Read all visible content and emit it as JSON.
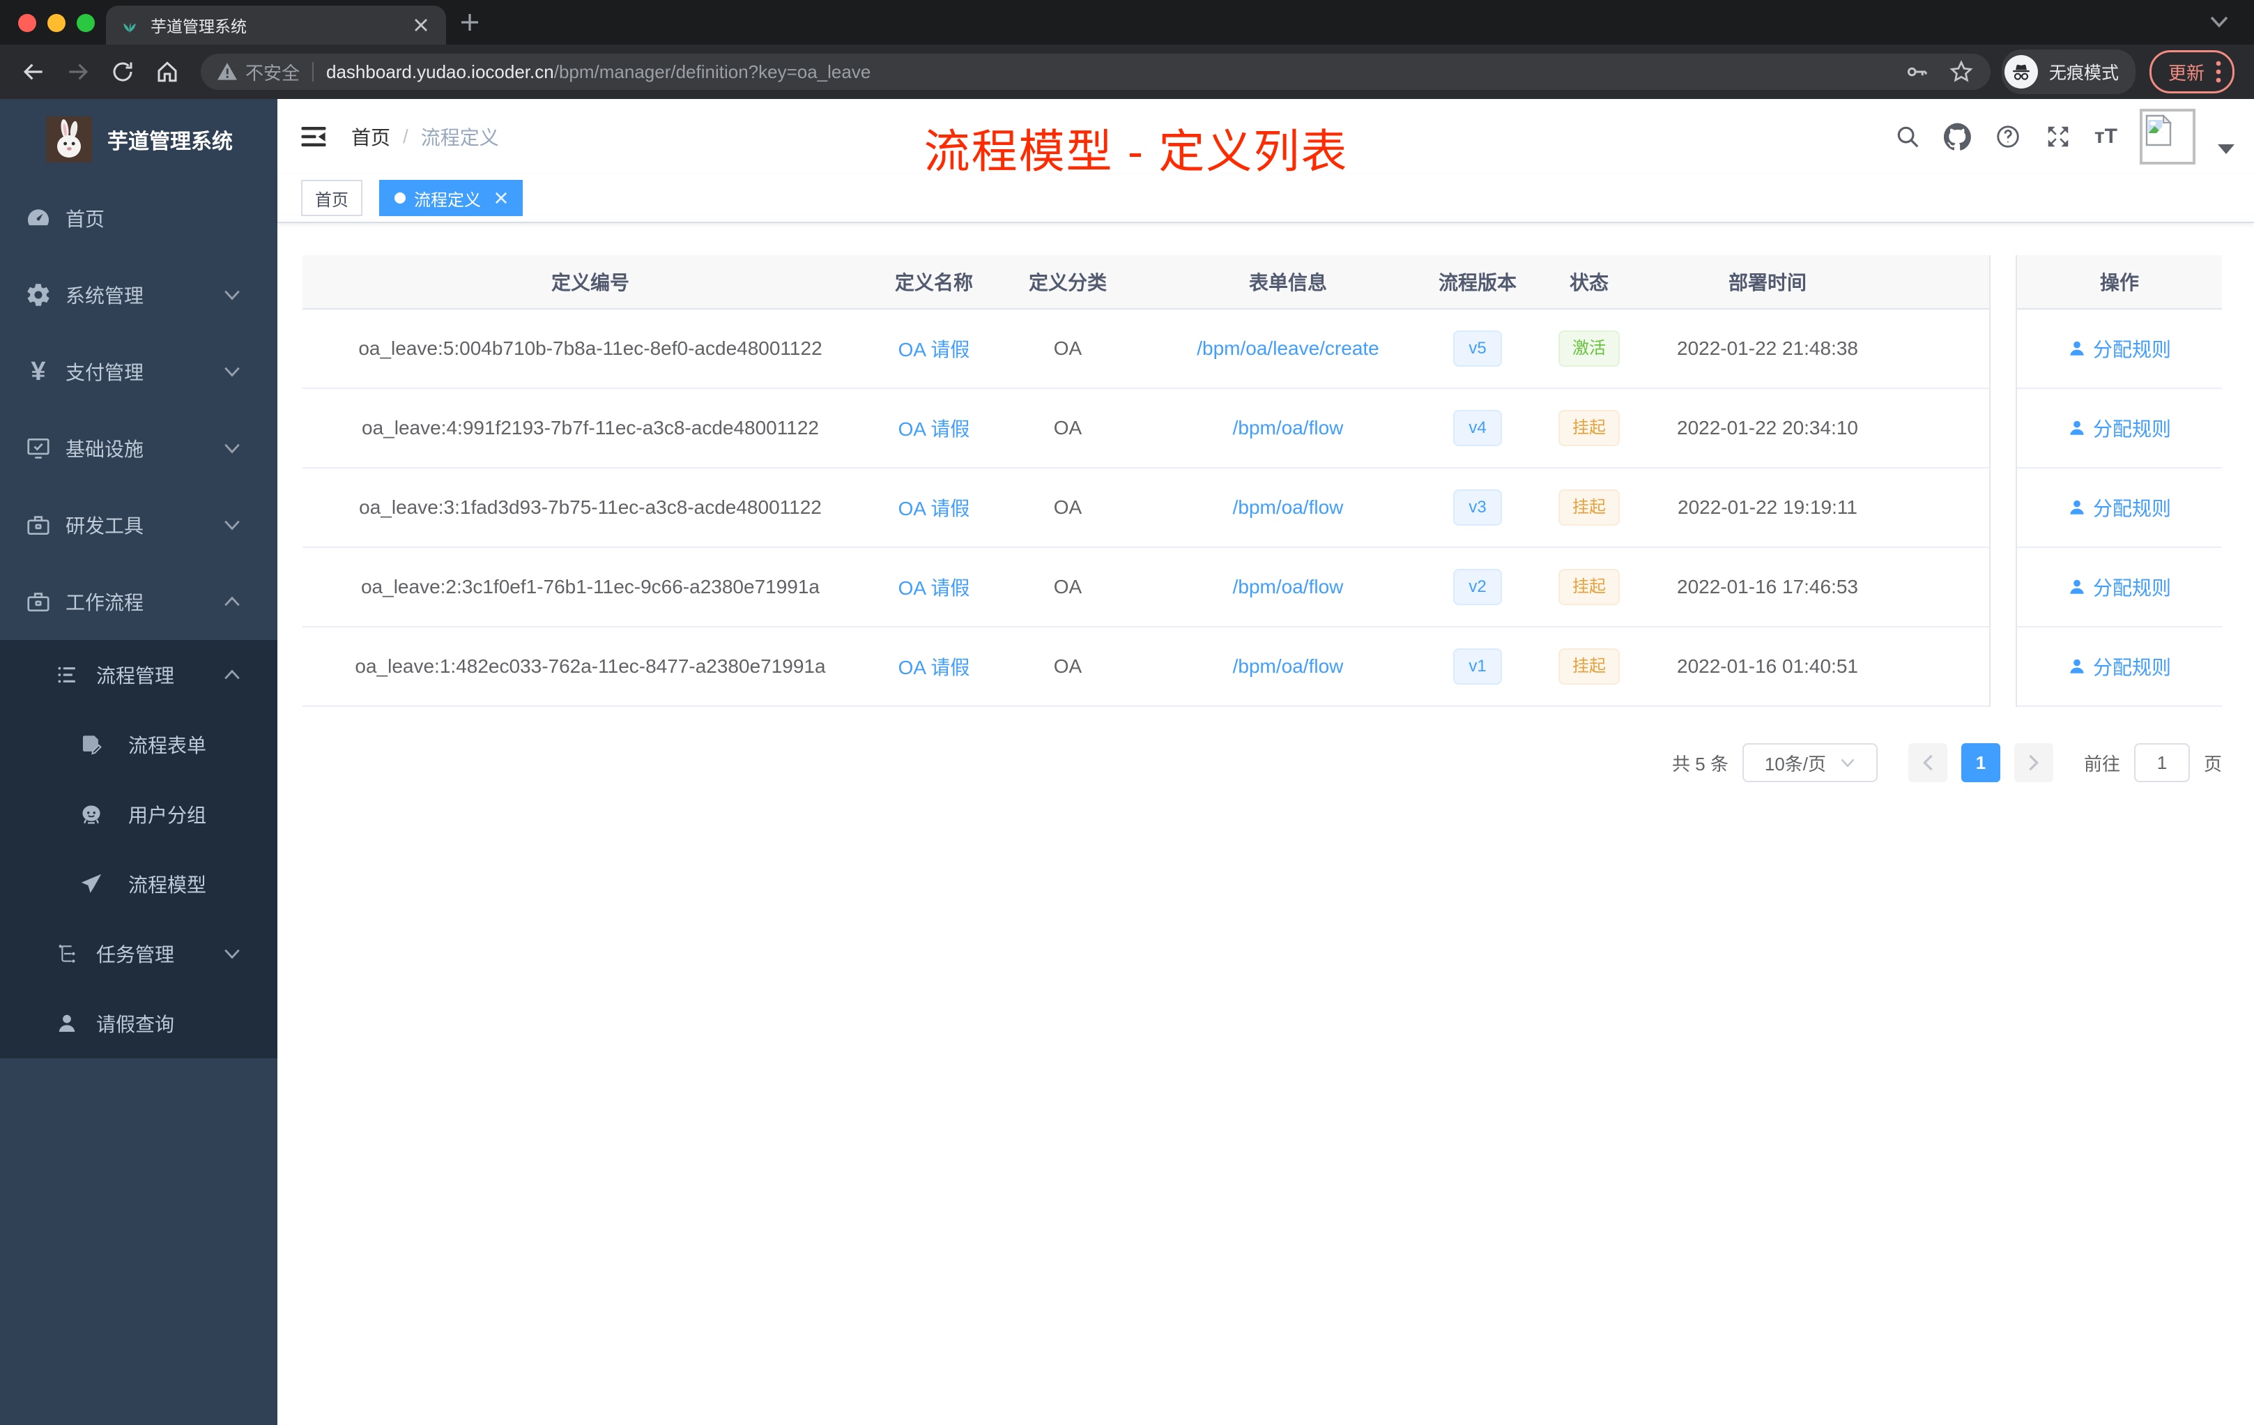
{
  "colors": {
    "accent": "#409eff",
    "success_text": "#67c23a",
    "warning_text": "#e6a23c",
    "annotation_red": "#ff2b00",
    "sidebar_bg": "#304156",
    "submenu_bg": "#1f2d3d"
  },
  "browser": {
    "tab_title": "芋道管理系统",
    "security_label": "不安全",
    "url_host": "dashboard.yudao.iocoder.cn",
    "url_path": "/bpm/manager/definition?key=oa_leave",
    "incognito_label": "无痕模式",
    "update_label": "更新"
  },
  "app_header": {
    "breadcrumb_home": "首页",
    "breadcrumb_sep": "/",
    "breadcrumb_current": "流程定义",
    "annotation": "流程模型 - 定义列表"
  },
  "tags_view": {
    "tag_home": "首页",
    "tag_active": "流程定义"
  },
  "sidebar": {
    "logo_title": "芋道管理系统",
    "menu": [
      {
        "label": "首页"
      },
      {
        "label": "系统管理"
      },
      {
        "label": "支付管理"
      },
      {
        "label": "基础设施"
      },
      {
        "label": "研发工具"
      },
      {
        "label": "工作流程"
      }
    ],
    "submenu": [
      {
        "label": "流程管理"
      },
      {
        "label": "流程表单"
      },
      {
        "label": "用户分组"
      },
      {
        "label": "流程模型"
      },
      {
        "label": "任务管理"
      },
      {
        "label": "请假查询"
      }
    ]
  },
  "table": {
    "columns": [
      {
        "label": "定义编号"
      },
      {
        "label": "定义名称"
      },
      {
        "label": "定义分类"
      },
      {
        "label": "表单信息"
      },
      {
        "label": "流程版本"
      },
      {
        "label": "状态"
      },
      {
        "label": "部署时间"
      },
      {
        "label": "操作"
      }
    ],
    "rows": [
      {
        "id": "oa_leave:5:004b710b-7b8a-11ec-8ef0-acde48001122",
        "name": "OA 请假",
        "category": "OA",
        "form": "/bpm/oa/leave/create",
        "version": "v5",
        "status": "激活",
        "deploy_time": "2022-01-22 21:48:38",
        "action": "分配规则"
      },
      {
        "id": "oa_leave:4:991f2193-7b7f-11ec-a3c8-acde48001122",
        "name": "OA 请假",
        "category": "OA",
        "form": "/bpm/oa/flow",
        "version": "v4",
        "status": "挂起",
        "deploy_time": "2022-01-22 20:34:10",
        "action": "分配规则"
      },
      {
        "id": "oa_leave:3:1fad3d93-7b75-11ec-a3c8-acde48001122",
        "name": "OA 请假",
        "category": "OA",
        "form": "/bpm/oa/flow",
        "version": "v3",
        "status": "挂起",
        "deploy_time": "2022-01-22 19:19:11",
        "action": "分配规则"
      },
      {
        "id": "oa_leave:2:3c1f0ef1-76b1-11ec-9c66-a2380e71991a",
        "name": "OA 请假",
        "category": "OA",
        "form": "/bpm/oa/flow",
        "version": "v2",
        "status": "挂起",
        "deploy_time": "2022-01-16 17:46:53",
        "action": "分配规则"
      },
      {
        "id": "oa_leave:1:482ec033-762a-11ec-8477-a2380e71991a",
        "name": "OA 请假",
        "category": "OA",
        "form": "/bpm/oa/flow",
        "version": "v1",
        "status": "挂起",
        "deploy_time": "2022-01-16 01:40:51",
        "action": "分配规则"
      }
    ]
  },
  "pagination": {
    "total": "共 5 条",
    "page_size": "10条/页",
    "page": "1",
    "goto": "前往",
    "goto_value": "1",
    "unit": "页"
  }
}
